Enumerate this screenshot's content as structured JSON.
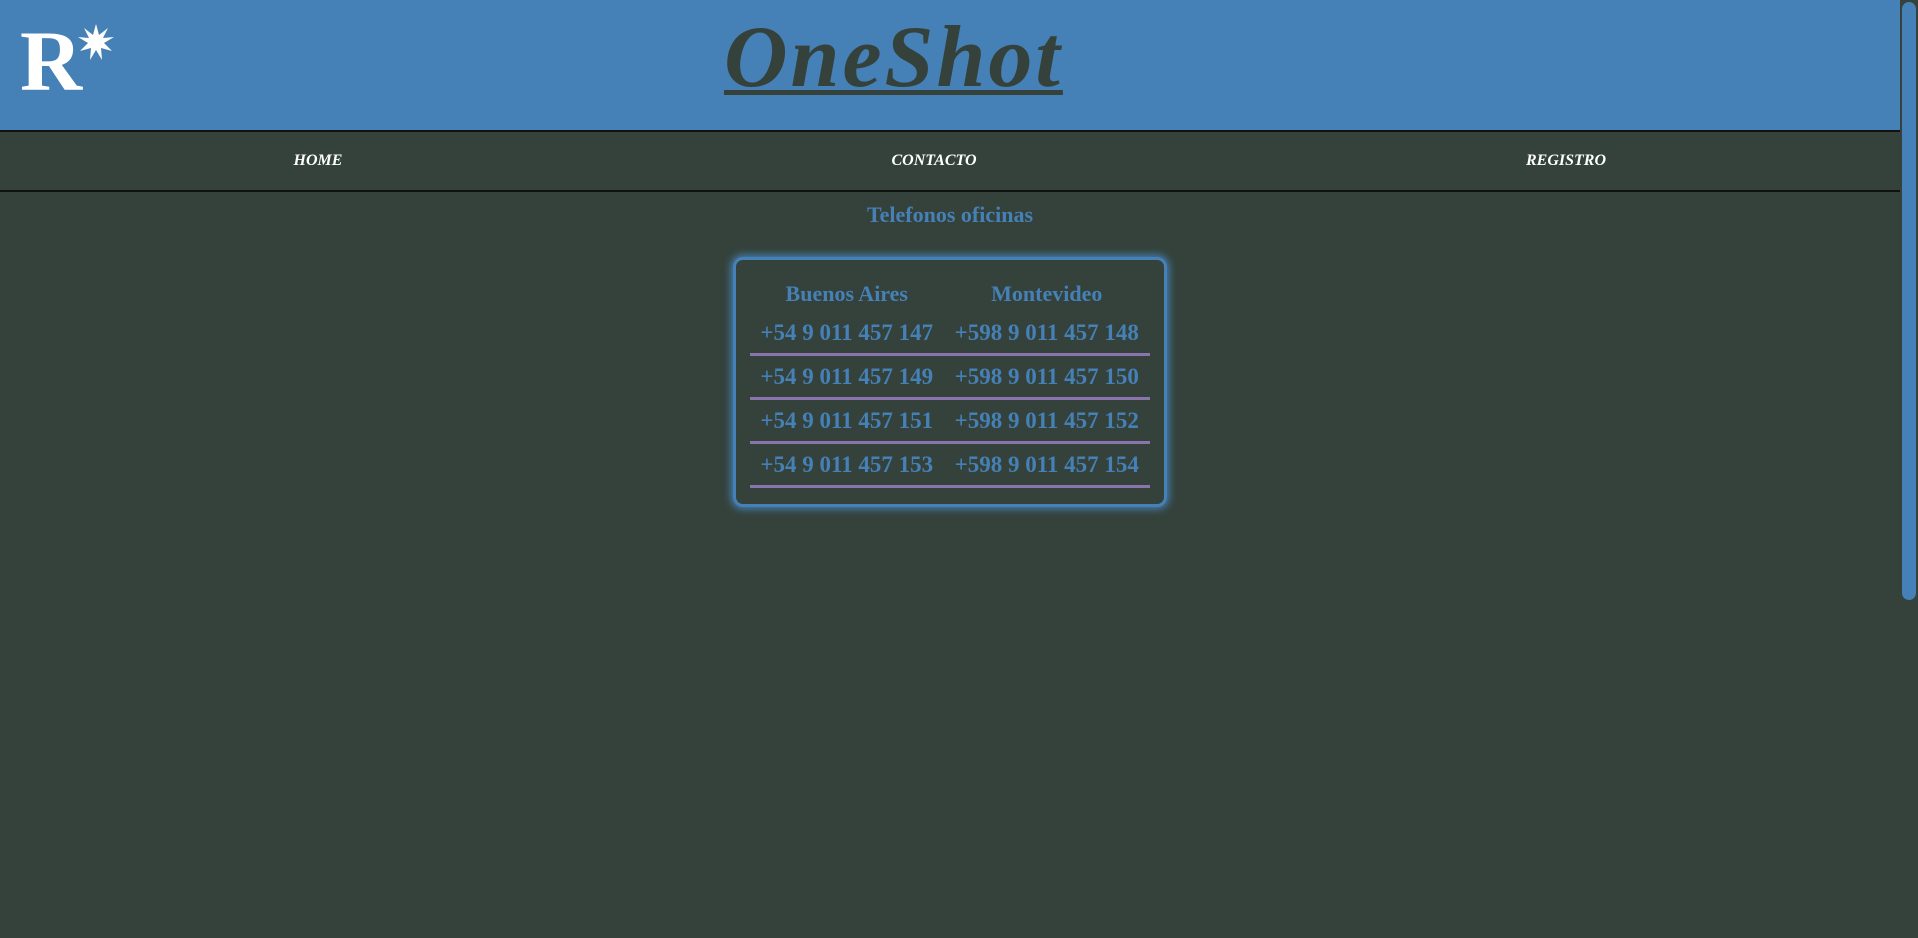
{
  "header": {
    "logo_letter": "R",
    "brand": "OneShot"
  },
  "nav": {
    "items": [
      {
        "label": "HOME"
      },
      {
        "label": "CONTACTO"
      },
      {
        "label": "REGISTRO"
      }
    ]
  },
  "main": {
    "title": "Telefonos oficinas",
    "table": {
      "headers": [
        "Buenos Aires",
        "Montevideo"
      ],
      "rows": [
        [
          "+54 9 011 457 147",
          "+598 9 011 457 148"
        ],
        [
          "+54 9 011 457 149",
          "+598 9 011 457 150"
        ],
        [
          "+54 9 011 457 151",
          "+598 9 011 457 152"
        ],
        [
          "+54 9 011 457 153",
          "+598 9 011 457 154"
        ]
      ]
    }
  },
  "colors": {
    "header_bg": "#4580b6",
    "page_bg": "#35423b",
    "accent": "#4580b6",
    "row_divider": "#8a74ad"
  },
  "icons": {
    "logo_star": "starburst-icon"
  }
}
